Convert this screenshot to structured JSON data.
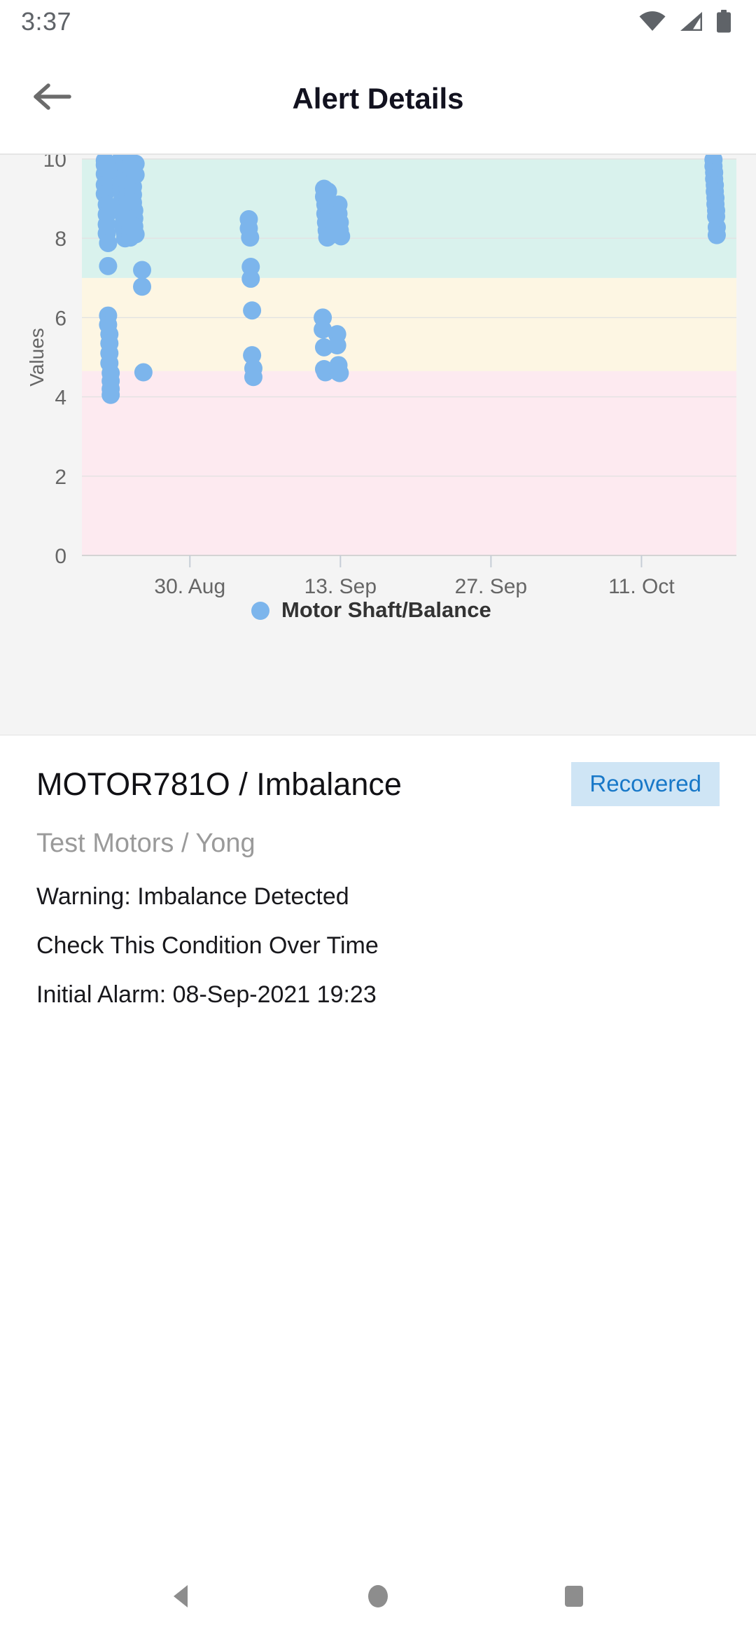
{
  "status_bar": {
    "time": "3:37",
    "icons": [
      "wifi-icon",
      "cellular-signal-icon",
      "battery-icon"
    ]
  },
  "app_bar": {
    "title": "Alert Details",
    "back_icon": "arrow-left-icon"
  },
  "chart_data": {
    "type": "scatter",
    "title": "",
    "xlabel": "",
    "ylabel": "Values",
    "ylim": [
      0,
      10
    ],
    "yticks": [
      0,
      2,
      4,
      6,
      8,
      10
    ],
    "xticks": [
      "30. Aug",
      "13. Sep",
      "27. Sep",
      "11. Oct"
    ],
    "xtick_positions": [
      0.165,
      0.395,
      0.625,
      0.855
    ],
    "grid": true,
    "legend_position": "bottom",
    "series": [
      {
        "name": "Motor Shaft/Balance",
        "color": "#7cb5ec",
        "points": [
          [
            0.035,
            9.96
          ],
          [
            0.035,
            9.85
          ],
          [
            0.035,
            9.62
          ],
          [
            0.035,
            9.35
          ],
          [
            0.035,
            9.12
          ],
          [
            0.038,
            8.85
          ],
          [
            0.038,
            8.6
          ],
          [
            0.038,
            8.35
          ],
          [
            0.038,
            8.12
          ],
          [
            0.04,
            7.88
          ],
          [
            0.04,
            7.3
          ],
          [
            0.04,
            6.05
          ],
          [
            0.04,
            5.82
          ],
          [
            0.042,
            5.58
          ],
          [
            0.042,
            5.35
          ],
          [
            0.042,
            5.1
          ],
          [
            0.042,
            4.85
          ],
          [
            0.044,
            4.6
          ],
          [
            0.044,
            4.4
          ],
          [
            0.044,
            4.2
          ],
          [
            0.044,
            4.05
          ],
          [
            0.058,
            9.95
          ],
          [
            0.058,
            9.8
          ],
          [
            0.058,
            9.65
          ],
          [
            0.06,
            9.5
          ],
          [
            0.06,
            9.35
          ],
          [
            0.06,
            9.18
          ],
          [
            0.062,
            9.0
          ],
          [
            0.062,
            8.85
          ],
          [
            0.062,
            8.7
          ],
          [
            0.064,
            8.55
          ],
          [
            0.064,
            8.4
          ],
          [
            0.064,
            8.25
          ],
          [
            0.066,
            8.12
          ],
          [
            0.066,
            8.0
          ],
          [
            0.066,
            9.92
          ],
          [
            0.068,
            9.75
          ],
          [
            0.068,
            9.58
          ],
          [
            0.068,
            9.42
          ],
          [
            0.07,
            9.25
          ],
          [
            0.07,
            9.08
          ],
          [
            0.07,
            8.92
          ],
          [
            0.072,
            8.75
          ],
          [
            0.072,
            8.58
          ],
          [
            0.072,
            8.42
          ],
          [
            0.074,
            8.28
          ],
          [
            0.074,
            8.15
          ],
          [
            0.074,
            8.02
          ],
          [
            0.076,
            9.9
          ],
          [
            0.076,
            9.7
          ],
          [
            0.076,
            9.5
          ],
          [
            0.078,
            9.3
          ],
          [
            0.078,
            9.1
          ],
          [
            0.078,
            8.9
          ],
          [
            0.08,
            8.7
          ],
          [
            0.08,
            8.5
          ],
          [
            0.08,
            8.3
          ],
          [
            0.082,
            8.1
          ],
          [
            0.082,
            9.88
          ],
          [
            0.082,
            9.6
          ],
          [
            0.092,
            7.2
          ],
          [
            0.092,
            6.78
          ],
          [
            0.094,
            4.62
          ],
          [
            0.255,
            8.48
          ],
          [
            0.255,
            8.25
          ],
          [
            0.257,
            8.02
          ],
          [
            0.258,
            7.28
          ],
          [
            0.258,
            6.98
          ],
          [
            0.26,
            6.18
          ],
          [
            0.26,
            5.05
          ],
          [
            0.262,
            4.72
          ],
          [
            0.262,
            4.5
          ],
          [
            0.37,
            9.25
          ],
          [
            0.37,
            9.05
          ],
          [
            0.372,
            8.85
          ],
          [
            0.372,
            8.62
          ],
          [
            0.373,
            8.4
          ],
          [
            0.374,
            8.2
          ],
          [
            0.375,
            8.02
          ],
          [
            0.376,
            9.18
          ],
          [
            0.376,
            8.95
          ],
          [
            0.378,
            8.72
          ],
          [
            0.378,
            8.5
          ],
          [
            0.379,
            8.28
          ],
          [
            0.38,
            8.08
          ],
          [
            0.392,
            8.85
          ],
          [
            0.392,
            8.62
          ],
          [
            0.394,
            8.4
          ],
          [
            0.394,
            8.2
          ],
          [
            0.396,
            8.05
          ],
          [
            0.368,
            6.0
          ],
          [
            0.368,
            5.7
          ],
          [
            0.37,
            5.25
          ],
          [
            0.37,
            4.7
          ],
          [
            0.372,
            4.62
          ],
          [
            0.39,
            5.58
          ],
          [
            0.39,
            5.3
          ],
          [
            0.392,
            4.8
          ],
          [
            0.392,
            4.62
          ],
          [
            0.394,
            4.6
          ],
          [
            0.965,
            9.98
          ],
          [
            0.965,
            9.82
          ],
          [
            0.966,
            9.66
          ],
          [
            0.966,
            9.5
          ],
          [
            0.967,
            9.34
          ],
          [
            0.967,
            9.18
          ],
          [
            0.968,
            9.02
          ],
          [
            0.968,
            8.86
          ],
          [
            0.969,
            8.7
          ],
          [
            0.969,
            8.55
          ],
          [
            0.97,
            8.28
          ],
          [
            0.97,
            8.08
          ]
        ]
      }
    ],
    "plot_bands": [
      {
        "name": "critical-band",
        "from": 0,
        "to": 4.65,
        "color": "#fdeaf0"
      },
      {
        "name": "warning-band",
        "from": 4.65,
        "to": 7.0,
        "color": "#fdf6e3"
      },
      {
        "name": "normal-band",
        "from": 7.0,
        "to": 10,
        "color": "#d9f2ed"
      }
    ],
    "legend": [
      {
        "label": "Motor Shaft/Balance",
        "color": "#7cb5ec"
      }
    ]
  },
  "details": {
    "title": "MOTOR781O / Imbalance",
    "status_badge": "Recovered",
    "subtitle": "Test Motors / Yong",
    "lines": [
      "Warning: Imbalance Detected",
      "Check This Condition Over Time",
      "Initial Alarm: 08-Sep-2021 19:23"
    ]
  },
  "nav_bar": {
    "back": "nav-back-icon",
    "home": "nav-home-icon",
    "recents": "nav-recents-icon"
  },
  "colors": {
    "accent": "#7cb5ec",
    "badge_bg": "#cfe5f5",
    "badge_text": "#1878c8",
    "chart_bg": "#f4f4f4"
  }
}
